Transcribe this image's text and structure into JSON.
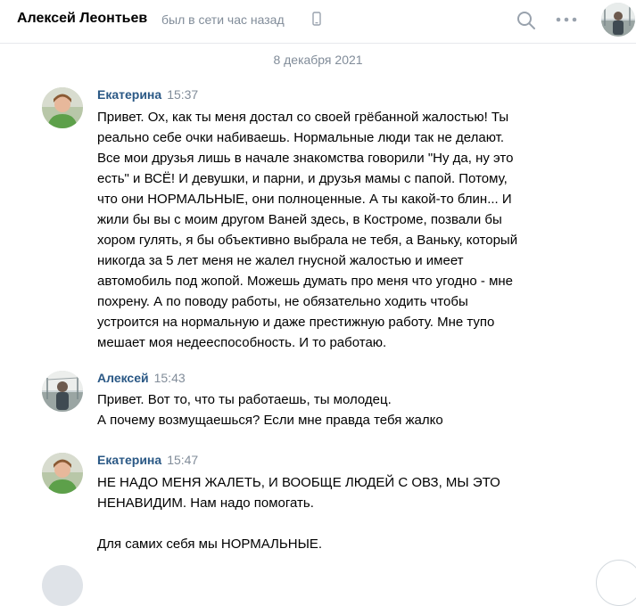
{
  "header": {
    "contact_name": "Алексей Леонтьев",
    "status": "был в сети час назад",
    "icons": [
      "mobile-phone-icon",
      "search-icon",
      "more-dots-icon",
      "avatar"
    ]
  },
  "date_separator": "8 декабря 2021",
  "messages": [
    {
      "author": "Екатерина",
      "time": "15:37",
      "lines": [
        "Привет. Ох, как ты меня достал со своей грёбанной жалостью! Ты",
        "реально себе очки набиваешь. Нормальные люди так не делают.",
        "Все мои друзья лишь в начале знакомства говорили \"Ну да, ну это",
        "есть\" и ВСЁ! И девушки, и парни, и друзья мамы с папой. Потому,",
        "что они НОРМАЛЬНЫЕ, они полноценные. А ты какой-то блин... И",
        "жили бы вы с моим другом Ваней здесь, в Костроме, позвали бы",
        "хором гулять, я бы объективно выбрала не тебя, а Ваньку, который",
        "никогда за 5 лет меня не жалел гнусной жалостью и имеет",
        "автомобиль под жопой. Можешь думать про меня что угодно - мне",
        "похрену. А по поводу работы, не обязательно ходить чтобы",
        "устроится на нормальную и даже престижную работу. Мне тупо",
        "мешает моя недееспособность. И то работаю."
      ]
    },
    {
      "author": "Алексей",
      "time": "15:43",
      "lines": [
        "Привет. Вот то, что ты работаешь, ты молодец.",
        "А почему возмущаешься? Если мне правда тебя жалко"
      ]
    },
    {
      "author": "Екатерина",
      "time": "15:47",
      "lines": [
        "НЕ НАДО МЕНЯ ЖАЛЕТЬ, И ВООБЩЕ ЛЮДЕЙ С ОВЗ, МЫ ЭТО",
        "НЕНАВИДИМ. Нам надо помогать.",
        "",
        "Для самих себя мы НОРМАЛЬНЫЕ."
      ]
    }
  ],
  "colors": {
    "author_link": "#2a5885",
    "muted": "#818c99",
    "divider": "#e7e8ec"
  }
}
